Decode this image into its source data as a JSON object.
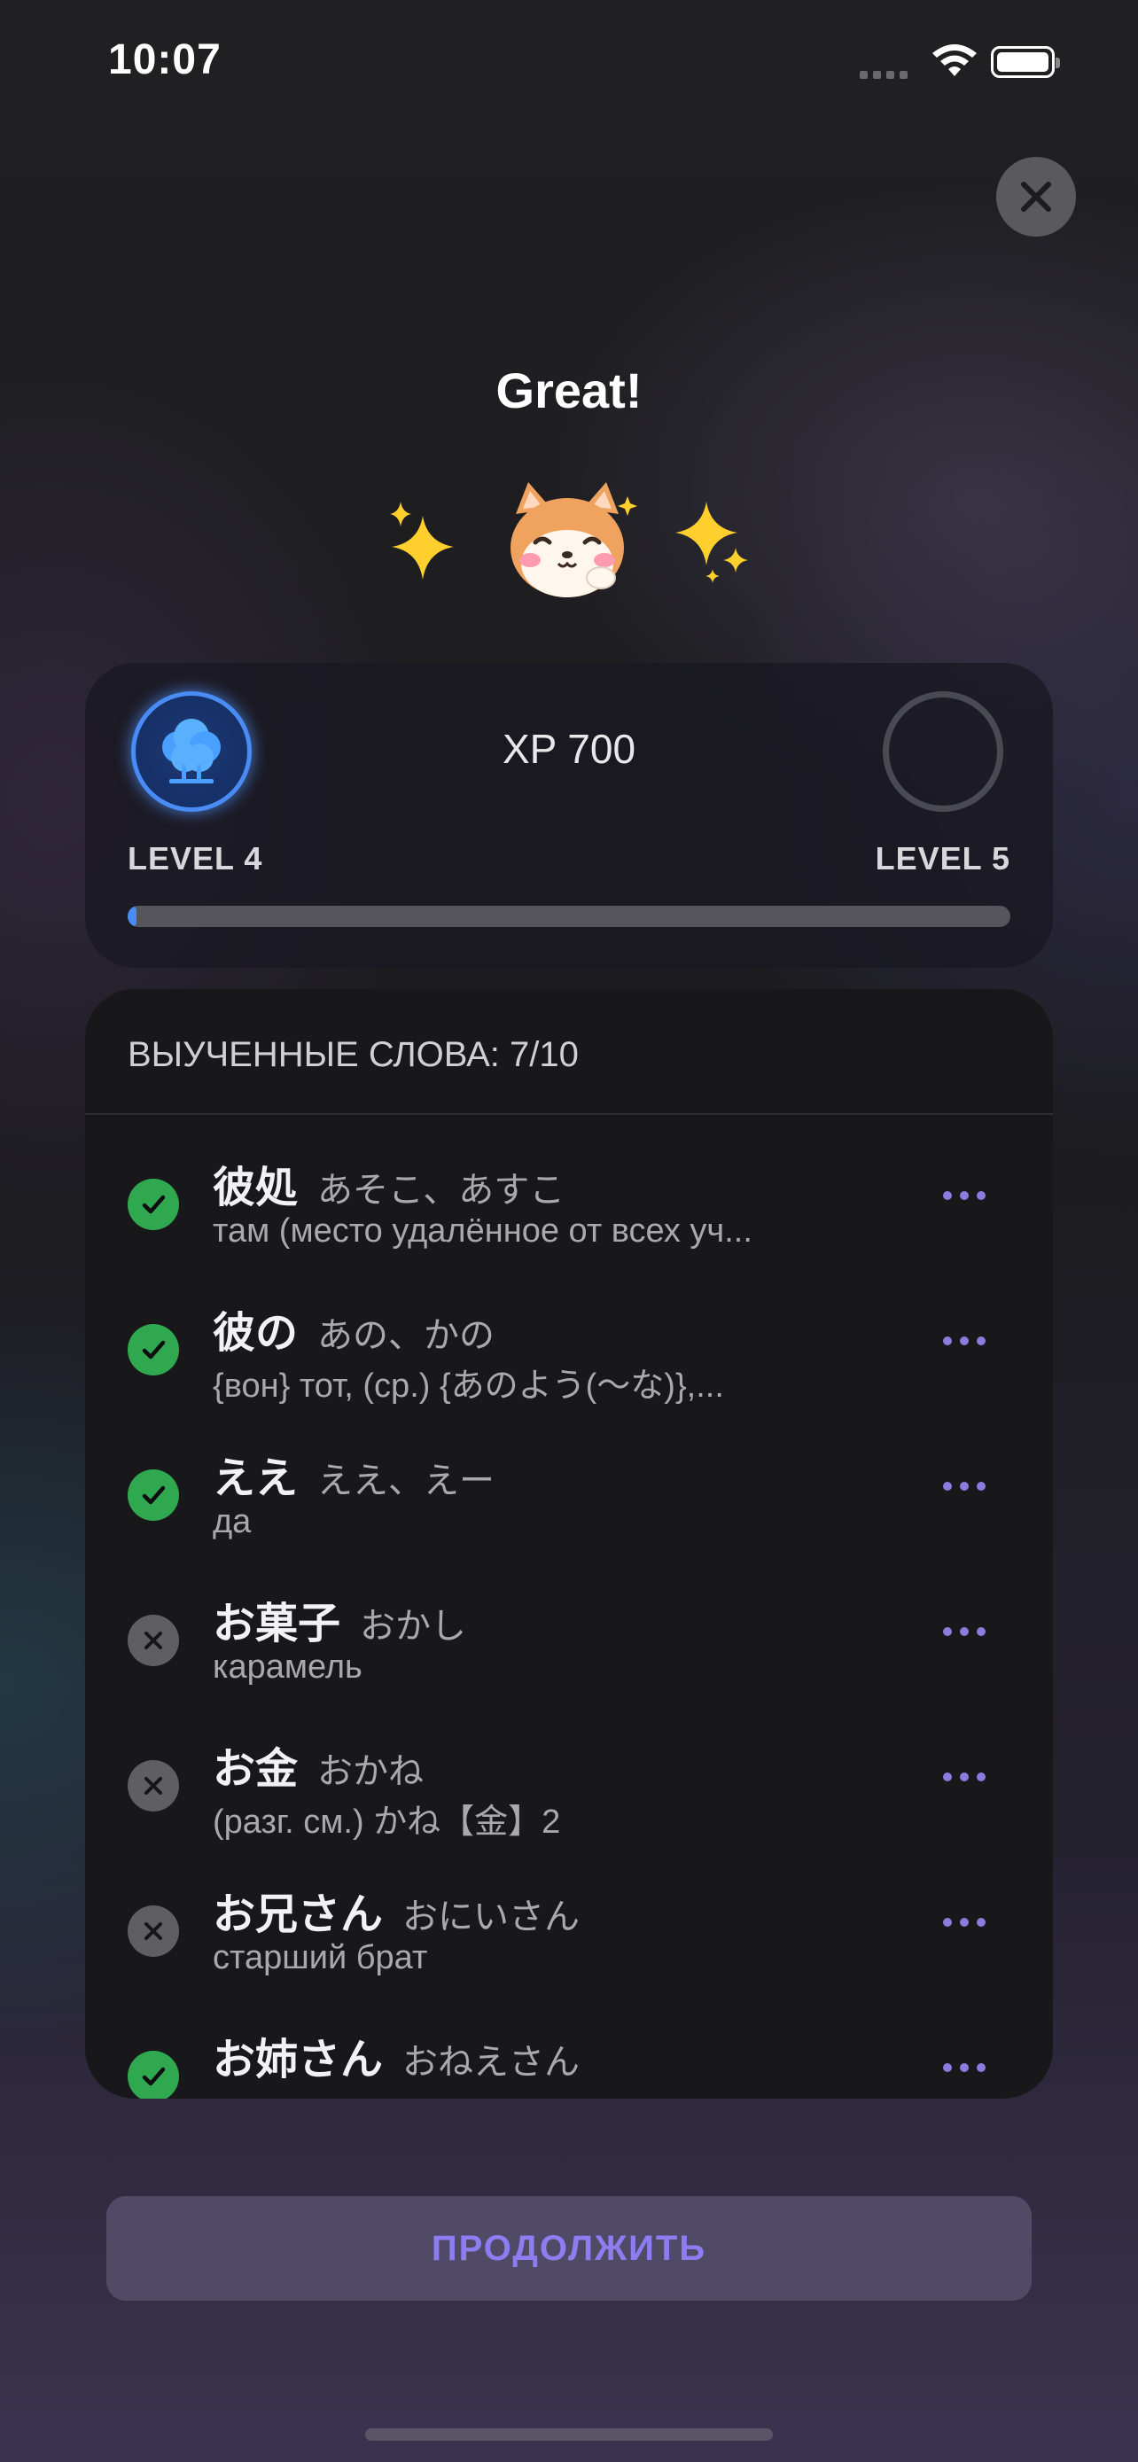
{
  "status_bar": {
    "time": "10:07"
  },
  "header": {
    "title": "Great!"
  },
  "mascot": {
    "icon": "shiba-cat-mascot-icon",
    "sparkle_icon": "sparkles-icon"
  },
  "level_card": {
    "xp_label": "XP 700",
    "current_level": "LEVEL 4",
    "next_level": "LEVEL 5",
    "progress_fraction": 0.01,
    "accent_color": "#4a8cf5"
  },
  "words": {
    "header": "ВЫУЧЕННЫЕ СЛОВА: 7/10",
    "items": [
      {
        "word": "彼処",
        "reading": "あそこ、あすこ",
        "translation": "там (место удалённое от всех уч...",
        "learned": true
      },
      {
        "word": "彼の",
        "reading": "あの、かの",
        "translation": "{вон} тот, (ср.) {あのよう(～な)},...",
        "learned": true
      },
      {
        "word": "ええ",
        "reading": "ええ、えー",
        "translation": "да",
        "learned": true
      },
      {
        "word": "お菓子",
        "reading": "おかし",
        "translation": "карамель",
        "learned": false
      },
      {
        "word": "お金",
        "reading": "おかね",
        "translation": "(разг. см.) かね【金】2",
        "learned": false
      },
      {
        "word": "お兄さん",
        "reading": "おにいさん",
        "translation": "старший брат",
        "learned": false
      },
      {
        "word": "お姉さん",
        "reading": "おねえさん",
        "translation": "",
        "learned": true
      }
    ]
  },
  "continue_button": {
    "label": "ПРОДОЛЖИТЬ"
  },
  "colors": {
    "learned": "#2fa84f",
    "not_learned": "#5e5e63",
    "menu_dots": "#8a7de0"
  }
}
